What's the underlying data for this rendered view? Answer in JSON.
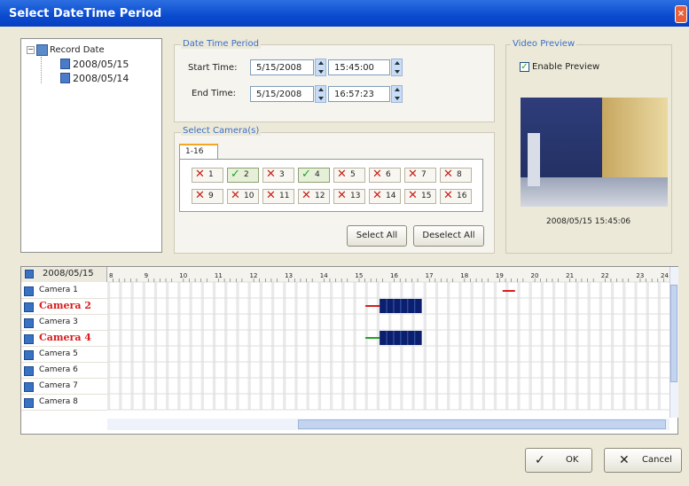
{
  "window": {
    "title": "Select DateTime Period",
    "close_label": "×"
  },
  "tree": {
    "root": "Record Date",
    "items": [
      "2008/05/15",
      "2008/05/14"
    ]
  },
  "datetime": {
    "group_title": "Date Time Period",
    "start_label": "Start Time:",
    "start_date": "5/15/2008",
    "start_time": "15:45:00",
    "end_label": "End Time:",
    "end_date": "5/15/2008",
    "end_time": "16:57:23"
  },
  "cameras": {
    "group_title": "Select Camera(s)",
    "tab": "1-16",
    "items": [
      {
        "n": "1",
        "on": false
      },
      {
        "n": "2",
        "on": true
      },
      {
        "n": "3",
        "on": false
      },
      {
        "n": "4",
        "on": true
      },
      {
        "n": "5",
        "on": false
      },
      {
        "n": "6",
        "on": false
      },
      {
        "n": "7",
        "on": false
      },
      {
        "n": "8",
        "on": false
      },
      {
        "n": "9",
        "on": false
      },
      {
        "n": "10",
        "on": false
      },
      {
        "n": "11",
        "on": false
      },
      {
        "n": "12",
        "on": false
      },
      {
        "n": "13",
        "on": false
      },
      {
        "n": "14",
        "on": false
      },
      {
        "n": "15",
        "on": false
      },
      {
        "n": "16",
        "on": false
      }
    ],
    "select_all": "Select All",
    "deselect_all": "Deselect All"
  },
  "preview": {
    "group_title": "Video Preview",
    "enable_label": "Enable Preview",
    "enabled": true,
    "timestamp": "2008/05/15 15:45:06"
  },
  "timeline": {
    "date": "2008/05/15",
    "hours": [
      "8",
      "9",
      "10",
      "11",
      "12",
      "13",
      "14",
      "15",
      "16",
      "17",
      "18",
      "19",
      "20",
      "21",
      "22",
      "23",
      "24"
    ],
    "rows": [
      {
        "name": "Camera 1",
        "hl": false
      },
      {
        "name": "Camera 2",
        "hl": true
      },
      {
        "name": "Camera 3",
        "hl": false
      },
      {
        "name": "Camera 4",
        "hl": true
      },
      {
        "name": "Camera 5",
        "hl": false
      },
      {
        "name": "Camera 6",
        "hl": false
      },
      {
        "name": "Camera 7",
        "hl": false
      },
      {
        "name": "Camera 8",
        "hl": false
      }
    ]
  },
  "buttons": {
    "ok": "OK",
    "cancel": "Cancel"
  },
  "colors": {
    "title_bar": "#0a4bd0",
    "accent_text": "#3a6fc8",
    "record_block": "#0b1f6e",
    "marker_red": "#d81d1d",
    "marker_green": "#1fa21f"
  }
}
